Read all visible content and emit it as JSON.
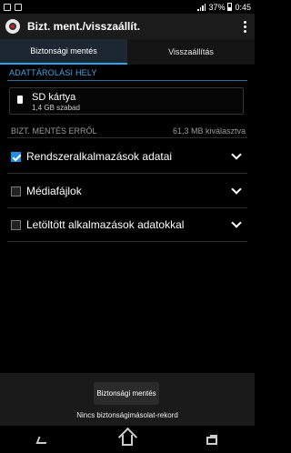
{
  "status": {
    "battery": "37%",
    "time": "0:45"
  },
  "app": {
    "title": "Bizt. ment./visszaállít."
  },
  "tabs": [
    {
      "label": "Biztonsági mentés",
      "active": true
    },
    {
      "label": "Visszaállítás",
      "active": false
    }
  ],
  "storage": {
    "header": "ADATTÁROLÁSI HELY",
    "location": "SD kártya",
    "free": "1,4 GB szabad"
  },
  "backup": {
    "header": "BIZT. MENTÉS ERRŐL",
    "size": "61,3 MB kiválasztva"
  },
  "options": [
    {
      "label": "Rendszeralkalmazások adatai",
      "checked": true
    },
    {
      "label": "Médiafájlok",
      "checked": false
    },
    {
      "label": "Letöltött alkalmazások adatokkal",
      "checked": false
    }
  ],
  "actions": {
    "primary_button": "Biztonsági mentés",
    "status": "Nincs biztonságimásolat-rekord"
  },
  "icons": {
    "app": "backup-app-icon",
    "overflow": "overflow-menu-icon",
    "sd": "sd-card-icon",
    "chevron": "chevron-down-icon"
  }
}
